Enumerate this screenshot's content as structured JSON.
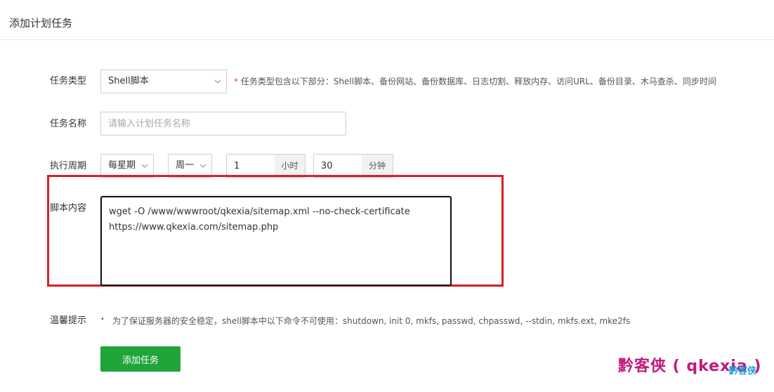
{
  "header": {
    "title": "添加计划任务"
  },
  "task_type": {
    "label": "任务类型",
    "selected": "Shell脚本",
    "hint_star": "*",
    "hint": "任务类型包含以下部分：Shell脚本、备份网站、备份数据库、日志切割、释放内存、访问URL、备份目录、木马查杀、同步时间"
  },
  "task_name": {
    "label": "任务名称",
    "placeholder": "请输入计划任务名称",
    "value": ""
  },
  "schedule": {
    "label": "执行周期",
    "period": "每星期",
    "weekday": "周一",
    "hour_value": "1",
    "hour_unit": "小时",
    "minute_value": "30",
    "minute_unit": "分钟"
  },
  "script": {
    "label": "脚本内容",
    "content": "wget -O /www/wwwroot/qkexia/sitemap.xml --no-check-certificate\nhttps://www.qkexia.com/sitemap.php"
  },
  "tip": {
    "label": "温馨提示",
    "bullet": "•",
    "text": "为了保证服务器的安全稳定，shell脚本中以下命令不可使用：shutdown, init 0, mkfs, passwd, chpasswd, --stdin, mkfs.ext, mke2fs"
  },
  "submit_label": "添加任务",
  "watermark": {
    "main": "黔客侠 ( qkexia )",
    "small": "黔客侠"
  },
  "colors": {
    "accent": "#20a53a",
    "highlight": "#d81e2a",
    "watermark": "#c2187c",
    "required_star": "#ef3d3d"
  }
}
